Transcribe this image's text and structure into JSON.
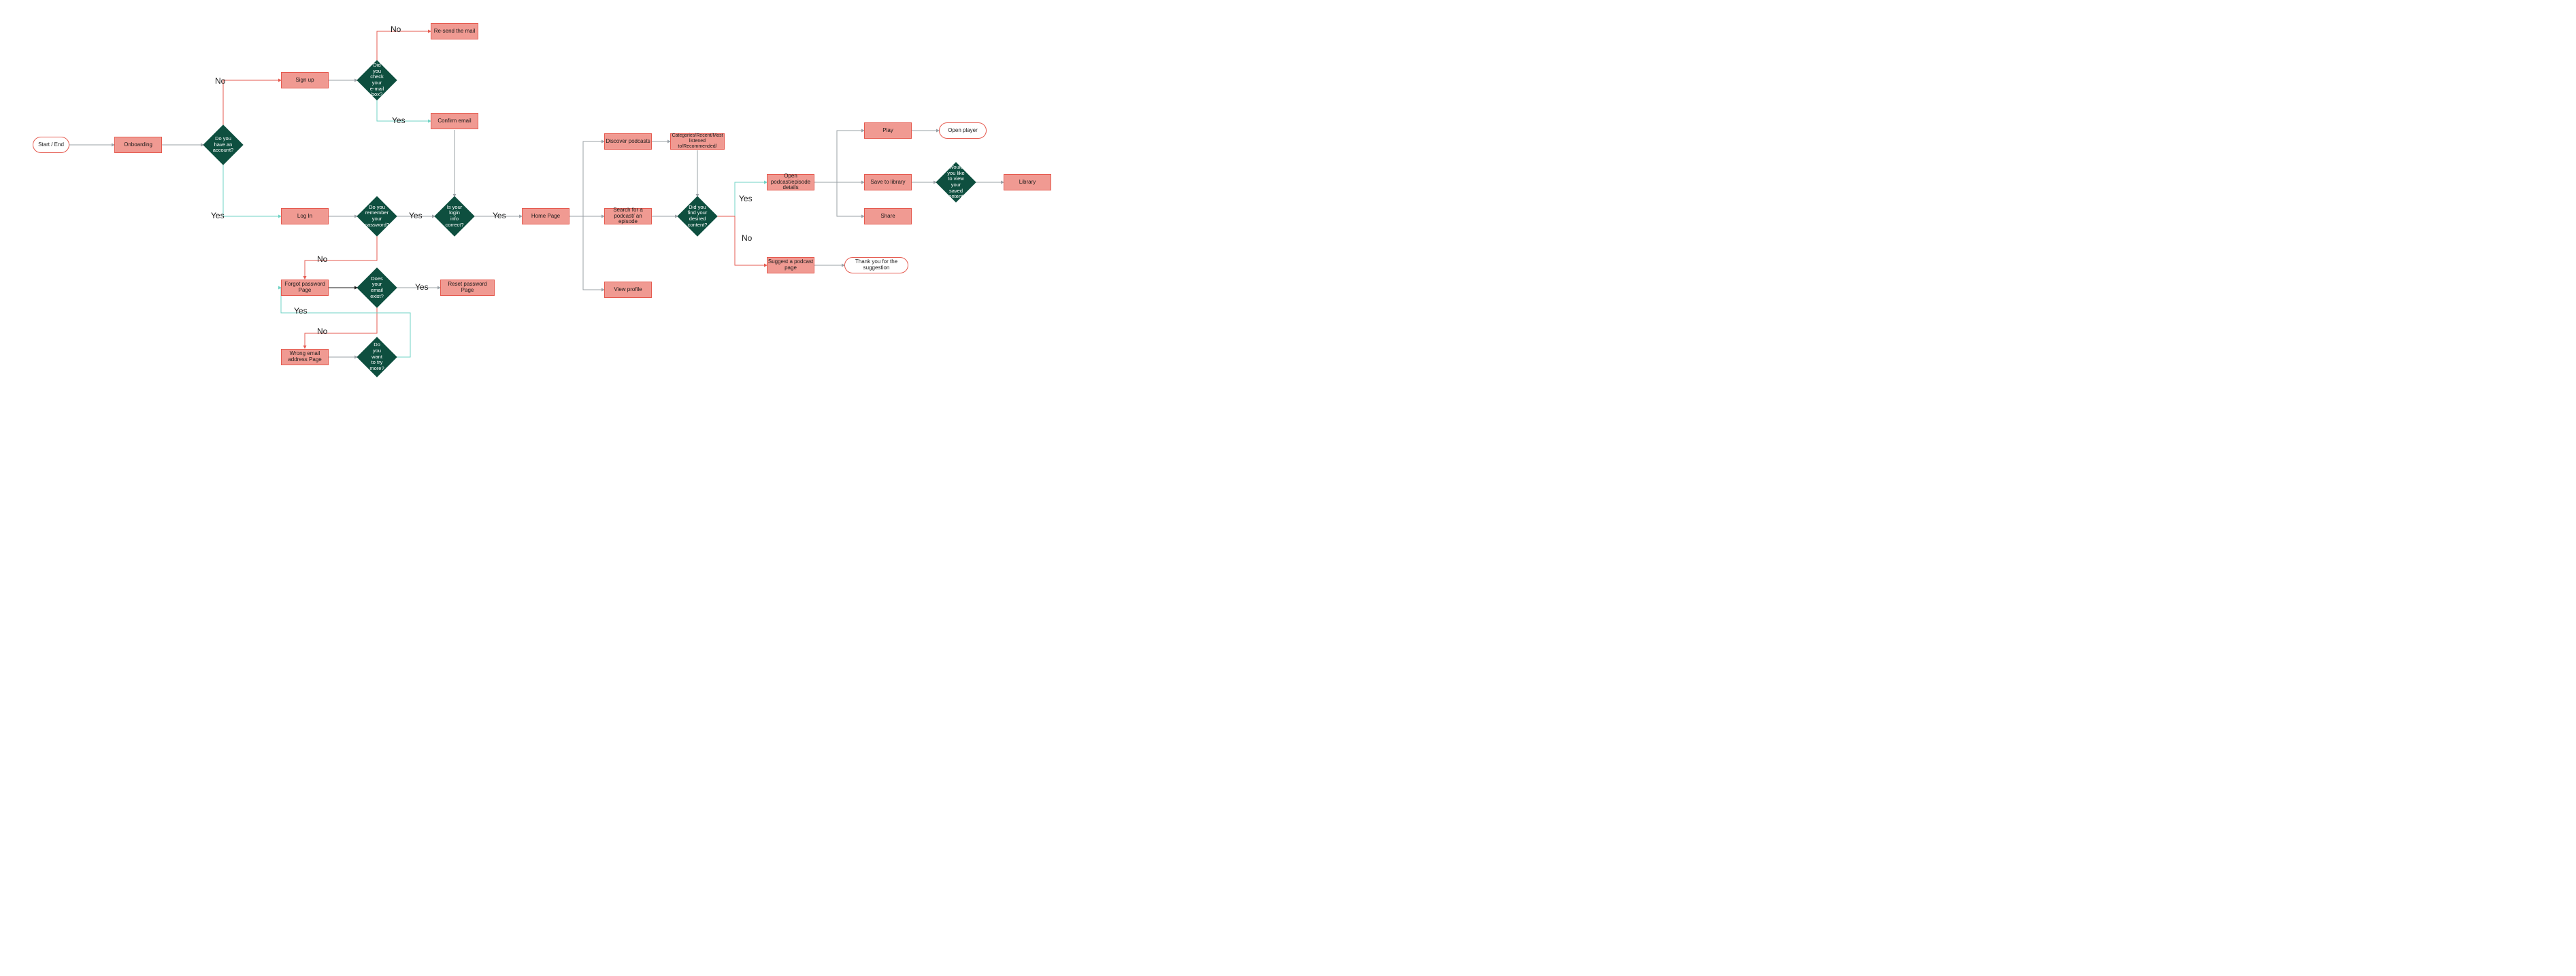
{
  "colors": {
    "process_fill": "#f09a92",
    "process_border": "#e55a4f",
    "decision_fill": "#0e4f3f",
    "terminal_border": "#e55a4f",
    "arrow_gray": "#9aa0a6",
    "arrow_red": "#e55a4f",
    "arrow_teal": "#6fd3c4"
  },
  "nodes": {
    "start_end": "Start / End",
    "onboarding": "Onboarding",
    "have_account": "Do you have an account?",
    "sign_up": "Sign up",
    "check_email": "Did you check your e-mail box?",
    "resend_mail": "Re-send the mail",
    "confirm_email": "Confirm email",
    "log_in": "Log In",
    "remember_password": "Do you remember your password?",
    "login_correct": "Is your login info correct?",
    "forgot_password_page": "Forgot password Page",
    "email_exist": "Does your email exist?",
    "reset_password_page": "Reset password Page",
    "wrong_email_page": "Wrong email address Page",
    "try_more": "Do you want to try more?",
    "home_page": "Home Page",
    "discover_podcasts": "Discover podcasts",
    "categories": "Categories/Recent/Most listened to/Recommended/",
    "search_podcast": "Search for a podcast/ an episode",
    "view_profile": "View profile",
    "find_content": "Did you find your desired content?",
    "open_podcast": "Open podcast/episode details",
    "suggest_podcast": "Suggest a podcast page",
    "thank_you": "Thank you for the suggestion",
    "play": "Play",
    "open_player": "Open player",
    "save_library": "Save to library",
    "view_saved": "Would you like to view your saved content?",
    "library": "Library",
    "share": "Share"
  },
  "edge_labels": {
    "yes": "Yes",
    "no": "No"
  }
}
